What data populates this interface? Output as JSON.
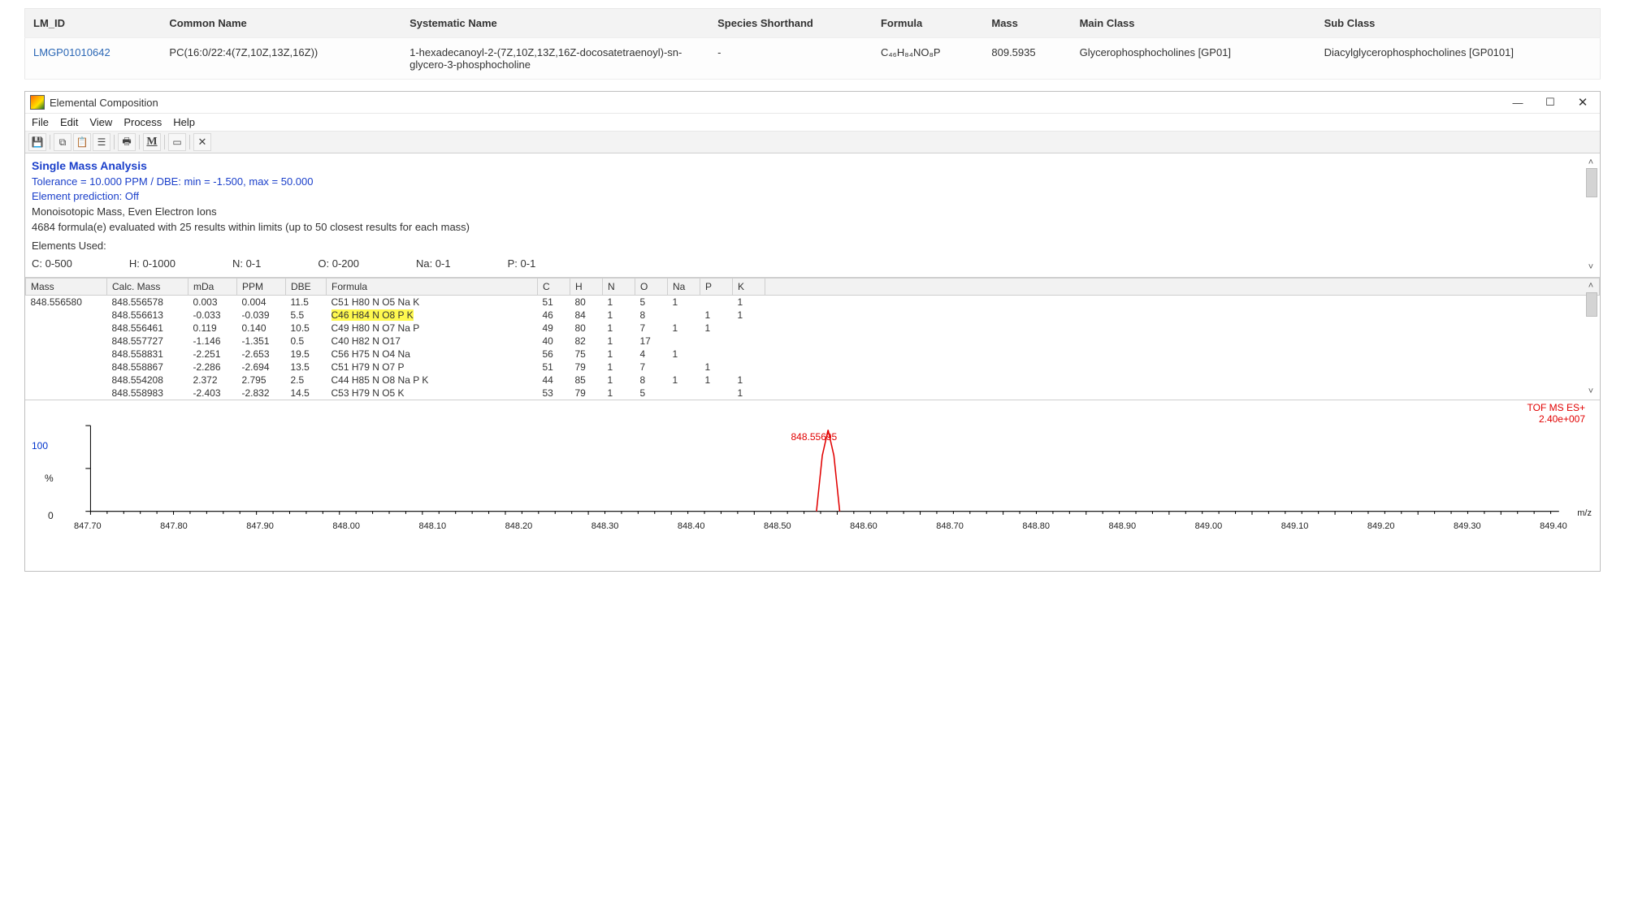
{
  "lipid_table": {
    "headers": [
      "LM_ID",
      "Common Name",
      "Systematic Name",
      "Species Shorthand",
      "Formula",
      "Mass",
      "Main Class",
      "Sub Class"
    ],
    "row": {
      "lm_id": "LMGP01010642",
      "common_name": "PC(16:0/22:4(7Z,10Z,13Z,16Z))",
      "systematic_name": "1-hexadecanoyl-2-(7Z,10Z,13Z,16Z-docosatetraenoyl)-sn-glycero-3-phosphocholine",
      "species_shorthand": "-",
      "formula_html": "C₄₆H₈₄NO₈P",
      "mass": "809.5935",
      "main_class": "Glycerophosphocholines [GP01]",
      "sub_class": "Diacylglycerophosphocholines [GP0101]"
    }
  },
  "window": {
    "title": "Elemental Composition",
    "menus": [
      "File",
      "Edit",
      "View",
      "Process",
      "Help"
    ],
    "controls": {
      "min": "—",
      "max": "☐",
      "close": "✕"
    }
  },
  "toolbar_icons": [
    "save-icon",
    "copy-icon",
    "paste-icon",
    "properties-icon",
    "print-icon",
    "mass-icon",
    "window-icon",
    "clear-icon"
  ],
  "analysis": {
    "title": "Single Mass Analysis",
    "tolerance_line": "Tolerance = 10.000 PPM   /   DBE: min = -1.500, max = 50.000",
    "element_prediction": "Element prediction: Off",
    "mono_line": "Monoisotopic Mass, Even Electron Ions",
    "eval_line": "4684 formula(e) evaluated with 25 results within limits (up to 50 closest results for each mass)",
    "elements_used_label": "Elements Used:",
    "elements_used": [
      "C: 0-500",
      "H: 0-1000",
      "N: 0-1",
      "O: 0-200",
      "Na: 0-1",
      "P: 0-1"
    ]
  },
  "grid": {
    "headers": [
      "Mass",
      "Calc. Mass",
      "mDa",
      "PPM",
      "DBE",
      "Formula",
      "C",
      "H",
      "N",
      "O",
      "Na",
      "P",
      "K"
    ],
    "mass": "848.556580",
    "rows": [
      {
        "calc": "848.556578",
        "mda": "0.003",
        "ppm": "0.004",
        "dbe": "11.5",
        "formula": "C51 H80 N O5 Na K",
        "c": "51",
        "h": "80",
        "n": "1",
        "o": "5",
        "na": "1",
        "p": "",
        "k": "1",
        "hl": false
      },
      {
        "calc": "848.556613",
        "mda": "-0.033",
        "ppm": "-0.039",
        "dbe": "5.5",
        "formula": "C46 H84 N O8 P K",
        "c": "46",
        "h": "84",
        "n": "1",
        "o": "8",
        "na": "",
        "p": "1",
        "k": "1",
        "hl": true
      },
      {
        "calc": "848.556461",
        "mda": "0.119",
        "ppm": "0.140",
        "dbe": "10.5",
        "formula": "C49 H80 N O7 Na P",
        "c": "49",
        "h": "80",
        "n": "1",
        "o": "7",
        "na": "1",
        "p": "1",
        "k": "",
        "hl": false
      },
      {
        "calc": "848.557727",
        "mda": "-1.146",
        "ppm": "-1.351",
        "dbe": "0.5",
        "formula": "C40 H82 N O17",
        "c": "40",
        "h": "82",
        "n": "1",
        "o": "17",
        "na": "",
        "p": "",
        "k": "",
        "hl": false
      },
      {
        "calc": "848.558831",
        "mda": "-2.251",
        "ppm": "-2.653",
        "dbe": "19.5",
        "formula": "C56 H75 N O4 Na",
        "c": "56",
        "h": "75",
        "n": "1",
        "o": "4",
        "na": "1",
        "p": "",
        "k": "",
        "hl": false
      },
      {
        "calc": "848.558867",
        "mda": "-2.286",
        "ppm": "-2.694",
        "dbe": "13.5",
        "formula": "C51 H79 N O7 P",
        "c": "51",
        "h": "79",
        "n": "1",
        "o": "7",
        "na": "",
        "p": "1",
        "k": "",
        "hl": false
      },
      {
        "calc": "848.554208",
        "mda": "2.372",
        "ppm": "2.795",
        "dbe": "2.5",
        "formula": "C44 H85 N O8 Na P K",
        "c": "44",
        "h": "85",
        "n": "1",
        "o": "8",
        "na": "1",
        "p": "1",
        "k": "1",
        "hl": false
      },
      {
        "calc": "848.558983",
        "mda": "-2.403",
        "ppm": "-2.832",
        "dbe": "14.5",
        "formula": "C53 H79 N O5 K",
        "c": "53",
        "h": "79",
        "n": "1",
        "o": "5",
        "na": "",
        "p": "",
        "k": "1",
        "hl": false
      }
    ]
  },
  "spectrum": {
    "tof_label": "TOF MS ES+",
    "intensity": "2.40e+007",
    "peak_label": "848.55695",
    "y100": "100",
    "ypct": "%",
    "y0": "0",
    "mz_label": "m/z",
    "xticks": [
      "847.70",
      "847.80",
      "847.90",
      "848.00",
      "848.10",
      "848.20",
      "848.30",
      "848.40",
      "848.50",
      "848.60",
      "848.70",
      "848.80",
      "848.90",
      "849.00",
      "849.10",
      "849.20",
      "849.30",
      "849.40"
    ]
  },
  "chart_data": {
    "type": "line",
    "title": "TOF MS ES+ spectrum",
    "xlabel": "m/z",
    "ylabel": "%",
    "ylim": [
      0,
      100
    ],
    "xlim": [
      847.7,
      849.4
    ],
    "max_intensity_counts": 24000000.0,
    "peaks": [
      {
        "mz": 848.55695,
        "rel_intensity_pct": 100
      }
    ]
  }
}
